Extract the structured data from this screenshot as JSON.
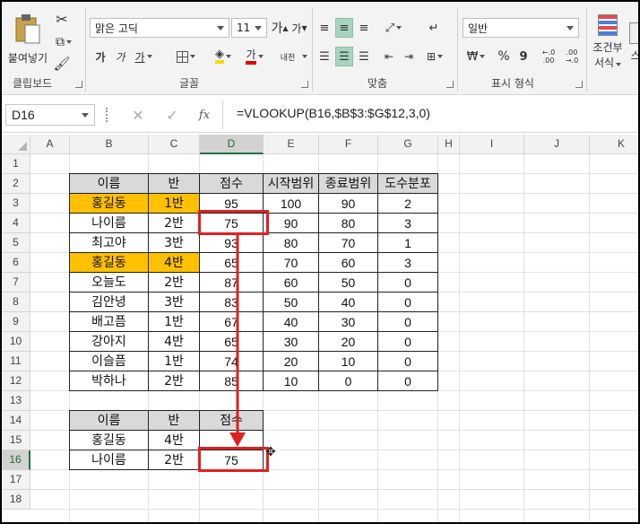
{
  "ribbon": {
    "paste_label": "붙여넣기",
    "clipboard_label": "클립보드",
    "font_name": "맑은 고딕",
    "font_size": "11",
    "font_group_label": "글꼴",
    "align_group_label": "맞춤",
    "number_format": "일반",
    "number_group_label": "표시 형식",
    "conditional_label_1": "조건부",
    "conditional_label_2": "서식",
    "style_partial": "스",
    "bold": "가",
    "italic": "가",
    "underline": "가",
    "grow_font": "가",
    "shrink_font": "가",
    "font_color_glyph": "가",
    "phonetic": "내천",
    "percent": "%",
    "comma": "9",
    "inc_dec_1": "←.0",
    "inc_dec_1b": ".00",
    "inc_dec_2": ".00",
    "inc_dec_2b": "→.0"
  },
  "formula_bar": {
    "name_box": "D16",
    "fx": "fx",
    "formula": "=VLOOKUP(B16,$B$3:$G$12,3,0)"
  },
  "columns": [
    "A",
    "B",
    "C",
    "D",
    "E",
    "F",
    "G",
    "H",
    "I",
    "J",
    "K"
  ],
  "rows": [
    "1",
    "2",
    "3",
    "4",
    "5",
    "6",
    "7",
    "8",
    "9",
    "10",
    "11",
    "12",
    "13",
    "14",
    "15",
    "16",
    "17",
    "18"
  ],
  "selected_cell": {
    "column": "D",
    "row": "16"
  },
  "main_table": {
    "headers": [
      "이름",
      "반",
      "점수",
      "시작범위",
      "종료범위",
      "도수분포"
    ],
    "rows": [
      {
        "name": "홍길동",
        "class": "1반",
        "score": "95",
        "start": "100",
        "end": "90",
        "freq": "2",
        "highlight": true
      },
      {
        "name": "나이름",
        "class": "2반",
        "score": "75",
        "start": "90",
        "end": "80",
        "freq": "3",
        "highlight": false
      },
      {
        "name": "최고야",
        "class": "3반",
        "score": "93",
        "start": "80",
        "end": "70",
        "freq": "1",
        "highlight": false
      },
      {
        "name": "홍길동",
        "class": "4반",
        "score": "65",
        "start": "70",
        "end": "60",
        "freq": "3",
        "highlight": true
      },
      {
        "name": "오늘도",
        "class": "2반",
        "score": "87",
        "start": "60",
        "end": "50",
        "freq": "0",
        "highlight": false
      },
      {
        "name": "김안녕",
        "class": "3반",
        "score": "83",
        "start": "50",
        "end": "40",
        "freq": "0",
        "highlight": false
      },
      {
        "name": "배고픔",
        "class": "1반",
        "score": "67",
        "start": "40",
        "end": "30",
        "freq": "0",
        "highlight": false
      },
      {
        "name": "강아지",
        "class": "4반",
        "score": "65",
        "start": "30",
        "end": "20",
        "freq": "0",
        "highlight": false
      },
      {
        "name": "이슬픔",
        "class": "1반",
        "score": "74",
        "start": "20",
        "end": "10",
        "freq": "0",
        "highlight": false
      },
      {
        "name": "박하나",
        "class": "2반",
        "score": "85",
        "start": "10",
        "end": "0",
        "freq": "0",
        "highlight": false
      }
    ]
  },
  "lookup_table": {
    "headers": [
      "이름",
      "반",
      "점수"
    ],
    "rows": [
      {
        "name": "홍길동",
        "class": "4반",
        "score": ""
      },
      {
        "name": "나이름",
        "class": "2반",
        "score": "75"
      }
    ]
  },
  "colors": {
    "highlight": "#ffc000",
    "header_fill": "#d9d9d9",
    "annotation": "#e02020",
    "excel_green": "#217346"
  }
}
